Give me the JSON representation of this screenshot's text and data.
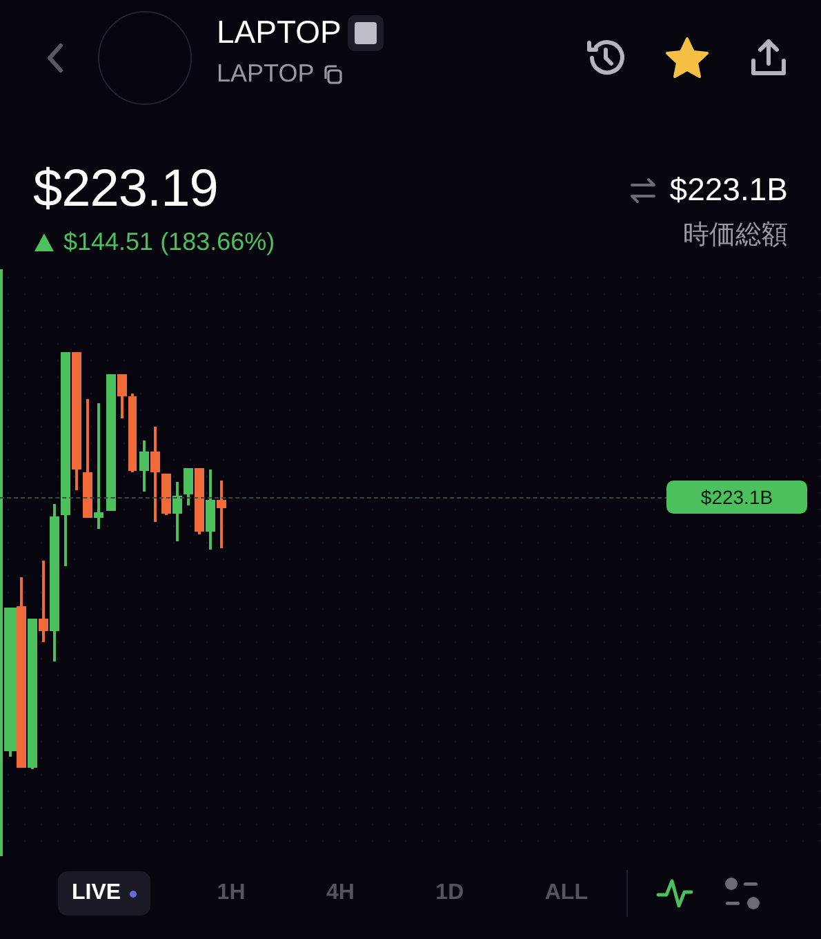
{
  "header": {
    "title": "LAPTOP",
    "subtitle": "LAPTOP",
    "favorite": true
  },
  "price": {
    "value": "$223.19",
    "change": "$144.51 (183.66%)",
    "kind": "gain"
  },
  "market_cap": {
    "value": "$223.1B",
    "label": "時価総額"
  },
  "chart": {
    "price_tag": "$223.1B"
  },
  "timeframes": [
    {
      "label": "LIVE",
      "selected": true,
      "live": true
    },
    {
      "label": "1H",
      "selected": false,
      "live": false
    },
    {
      "label": "4H",
      "selected": false,
      "live": false
    },
    {
      "label": "1D",
      "selected": false,
      "live": false
    },
    {
      "label": "ALL",
      "selected": false,
      "live": false
    }
  ],
  "line_mode": {
    "on": true
  }
}
